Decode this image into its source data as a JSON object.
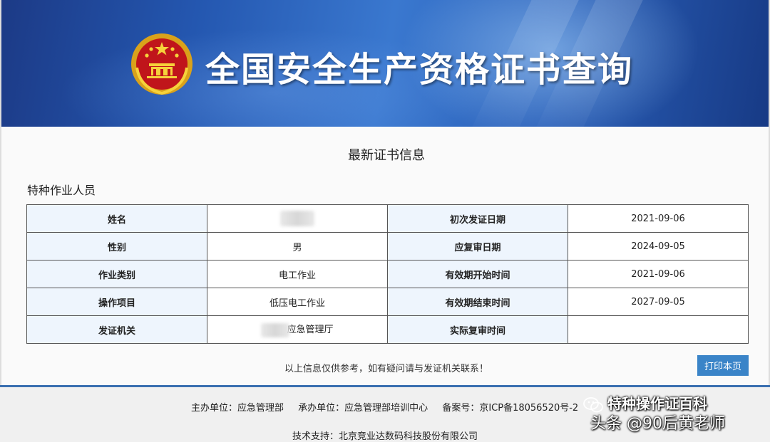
{
  "banner": {
    "title": "全国安全生产资格证书查询"
  },
  "section_title": "最新证书信息",
  "category": "特种作业人员",
  "rows": [
    {
      "label_left": "姓名",
      "value_left": "",
      "label_right": "初次发证日期",
      "value_right": "2021-09-06"
    },
    {
      "label_left": "性别",
      "value_left": "男",
      "label_right": "应复审日期",
      "value_right": "2024-09-05"
    },
    {
      "label_left": "作业类别",
      "value_left": "电工作业",
      "label_right": "有效期开始时间",
      "value_right": "2021-09-06"
    },
    {
      "label_left": "操作项目",
      "value_left": "低压电工作业",
      "label_right": "有效期结束时间",
      "value_right": "2027-09-05"
    },
    {
      "label_left": "发证机关",
      "value_left": "应急管理厅",
      "label_right": "实际复审时间",
      "value_right": ""
    }
  ],
  "notice": "以上信息仅供参考，如有疑问请与发证机关联系！",
  "print_label": "打印本页",
  "footer": {
    "host": "主办单位：应急管理部",
    "organizer": "承办单位：应急管理部培训中心",
    "icp": "备案号：京ICP备18056520号-2",
    "support": "技术支持：北京竞业达数码科技股份有限公司"
  },
  "watermark": {
    "line1": "特种操作证百科",
    "line2": "头条 @90后黄老师"
  },
  "colors": {
    "banner_blue": "#2457b0",
    "label_bg": "#eef5fd",
    "button": "#3a84c8",
    "footer_border": "#3a6fb0"
  }
}
